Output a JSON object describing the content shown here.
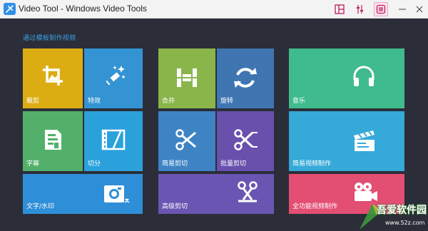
{
  "window": {
    "title": "Video Tool - Windows Video Tools",
    "toolbar_icons": [
      "layout-icon",
      "settings-sliders-icon",
      "menu-icon"
    ]
  },
  "section_title": "通过模板制作视频",
  "tiles": [
    {
      "name": "crop",
      "label": "裁剪",
      "color": "#dcad13",
      "icon": "crop-icon"
    },
    {
      "name": "effects",
      "label": "特效",
      "color": "#3393d3",
      "icon": "magic-wand-icon"
    },
    {
      "name": "subtitle",
      "label": "字幕",
      "color": "#52b06a",
      "icon": "document-icon"
    },
    {
      "name": "split",
      "label": "切分",
      "color": "#2ba1dc",
      "icon": "film-split-icon"
    },
    {
      "name": "text-watermark",
      "label": "文字/水印",
      "color": "#2f8ed8",
      "icon": "camera-icon"
    },
    {
      "name": "merge",
      "label": "合并",
      "color": "#8ab54a",
      "icon": "merge-icon"
    },
    {
      "name": "rotate",
      "label": "旋转",
      "color": "#3f76b2",
      "icon": "rotate-icon"
    },
    {
      "name": "simple-cut",
      "label": "简易剪切",
      "color": "#3e84c5",
      "icon": "scissors-icon"
    },
    {
      "name": "batch-cut",
      "label": "批量剪切",
      "color": "#6950ad",
      "icon": "scissors-icon"
    },
    {
      "name": "advanced-cut",
      "label": "高级剪切",
      "color": "#6a56b2",
      "icon": "scissors-advanced-icon"
    },
    {
      "name": "music",
      "label": "音乐",
      "color": "#3fbb8e",
      "icon": "headphones-icon"
    },
    {
      "name": "simple-video",
      "label": "简易视频制作",
      "color": "#35a9d8",
      "icon": "clapperboard-icon"
    },
    {
      "name": "full-video",
      "label": "全功能视频制作",
      "color": "#e34e73",
      "icon": "video-camera-icon"
    }
  ],
  "watermark": {
    "text": "吾爱软件园",
    "url": "www.52z.com"
  }
}
